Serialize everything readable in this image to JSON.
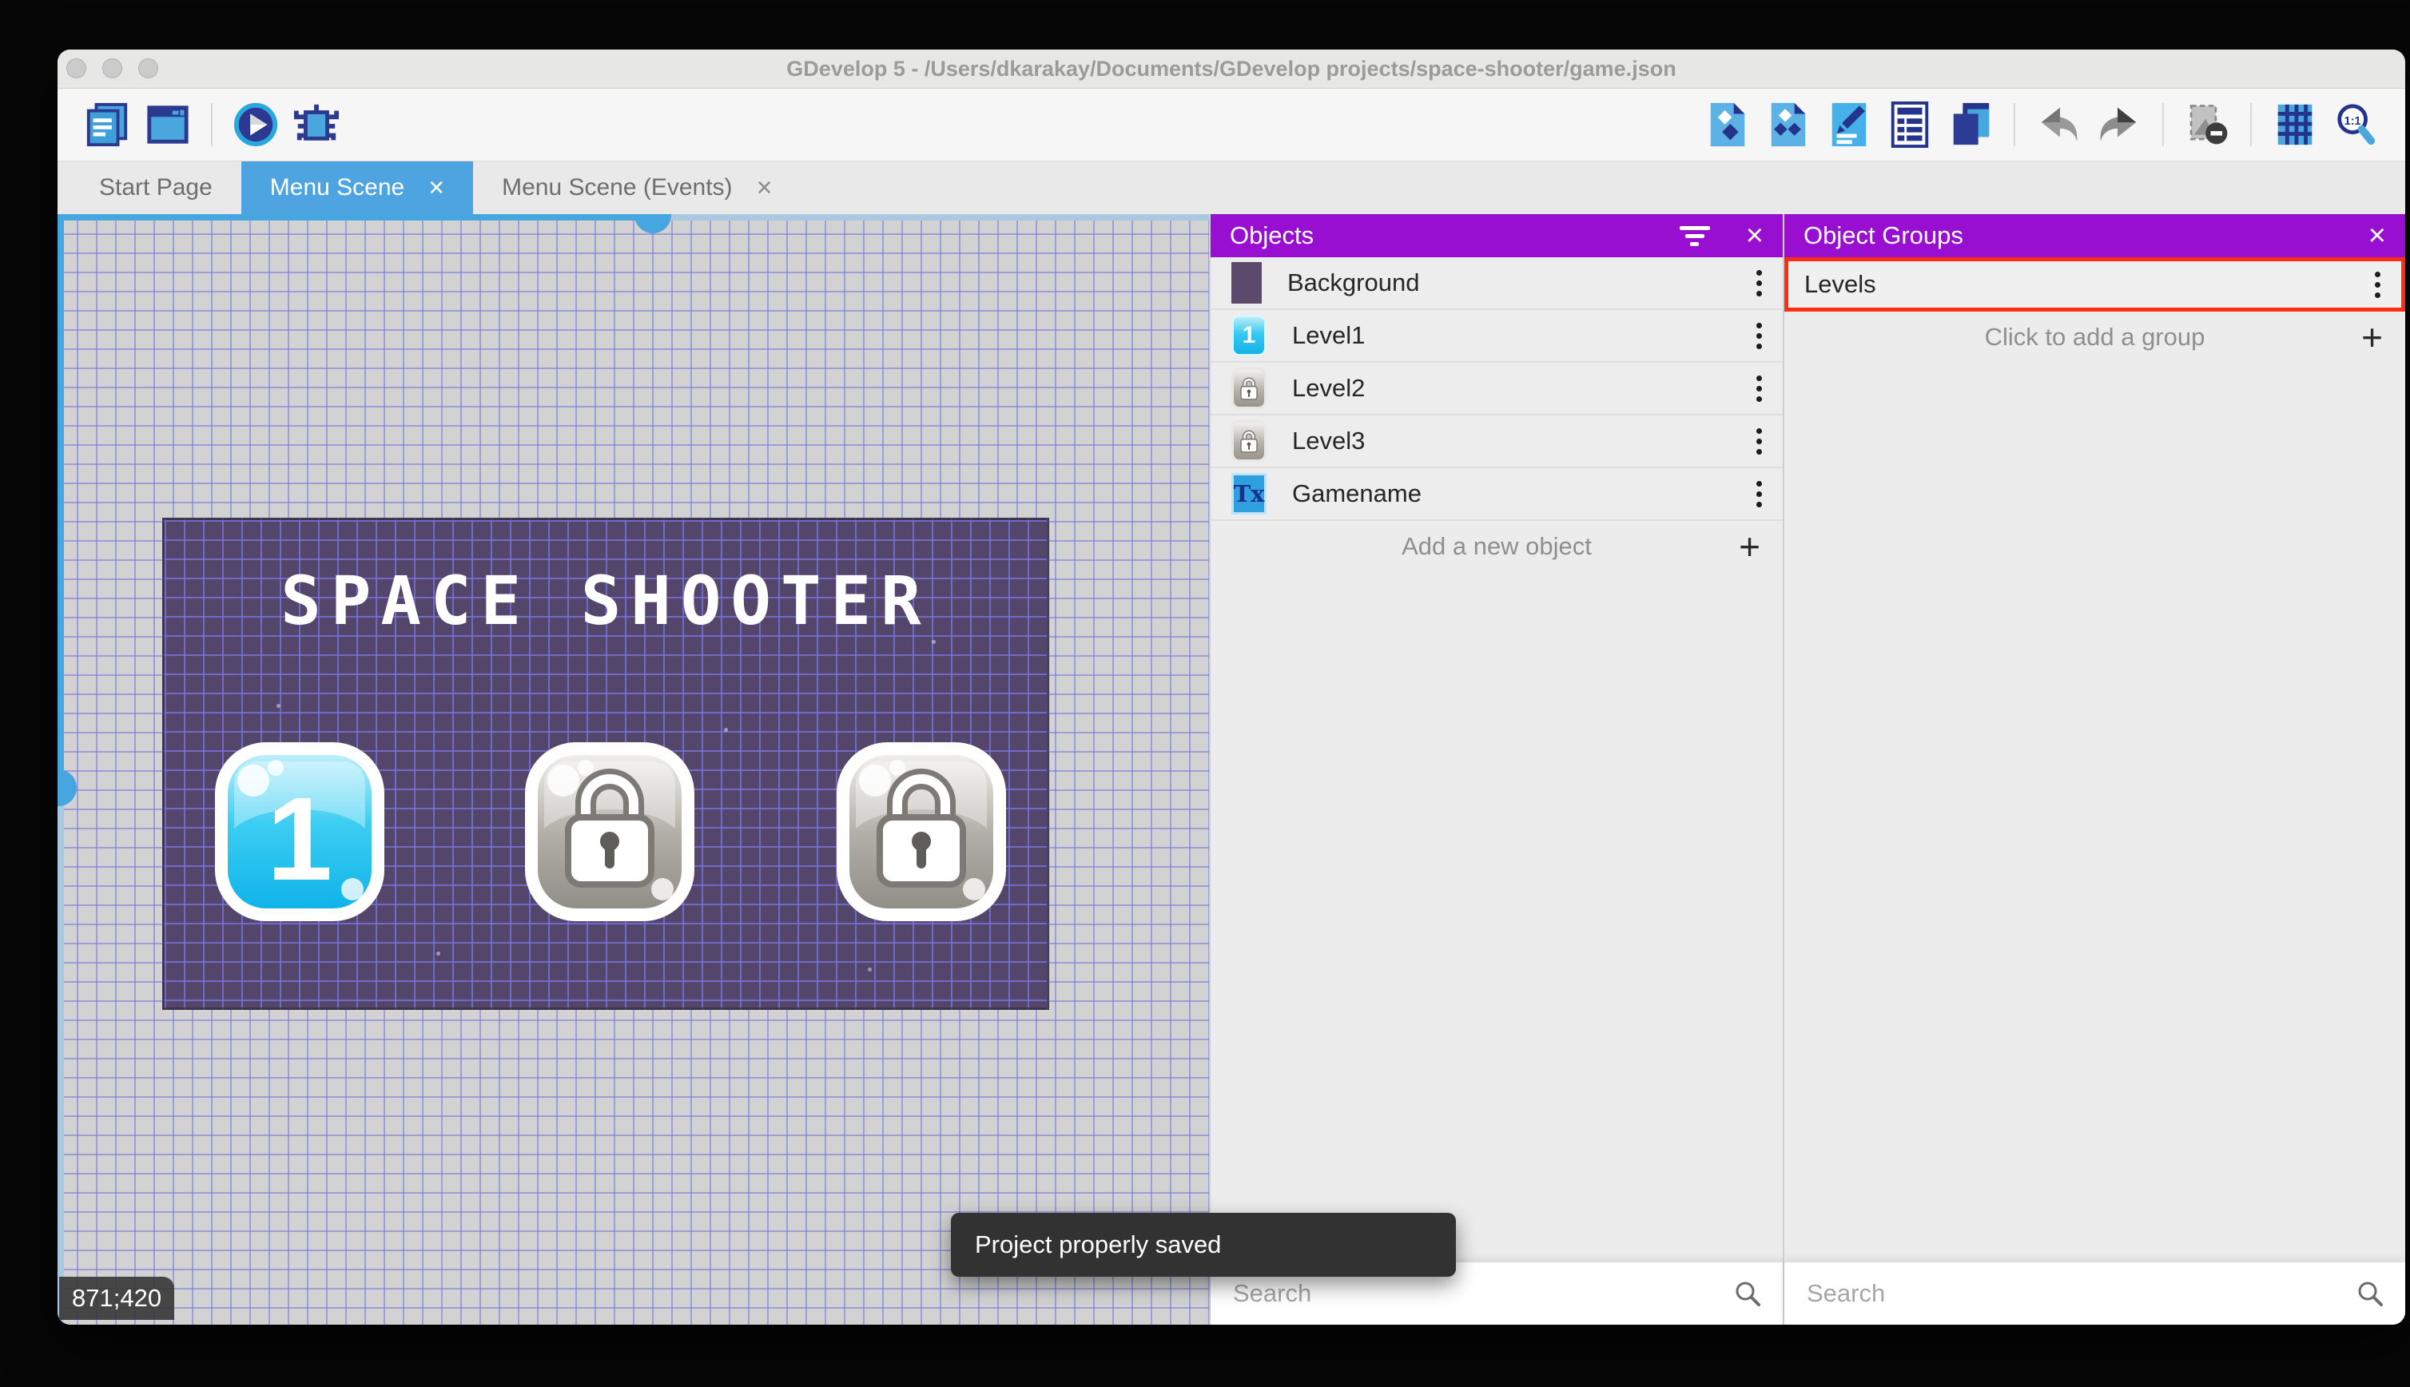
{
  "window": {
    "title": "GDevelop 5 - /Users/dkarakay/Documents/GDevelop projects/space-shooter/game.json"
  },
  "toolbar": {
    "left_icons": [
      "project-manager-icon",
      "scene-window-icon",
      "play-preview-icon",
      "debugger-icon"
    ],
    "right_icons": [
      "objects-panel-icon",
      "object-groups-panel-icon",
      "properties-icon",
      "instances-list-icon",
      "layers-icon",
      "undo-icon",
      "redo-icon",
      "mask-toggle-icon",
      "grid-toggle-icon",
      "zoom-original-icon"
    ],
    "zoom_ratio": "1:1"
  },
  "tabs": [
    {
      "label": "Start Page",
      "active": false,
      "closable": false
    },
    {
      "label": "Menu Scene",
      "active": true,
      "closable": true
    },
    {
      "label": "Menu Scene (Events)",
      "active": false,
      "closable": true
    }
  ],
  "glyphs": {
    "close": "×",
    "plus": "+"
  },
  "scene": {
    "title": "SPACE SHOOTER",
    "level1_label": "1",
    "coordinates": "871;420"
  },
  "objects_panel": {
    "title": "Objects",
    "items": [
      {
        "name": "Background",
        "thumb": "purple-rect"
      },
      {
        "name": "Level1",
        "thumb": "blue-button",
        "thumb_label": "1"
      },
      {
        "name": "Level2",
        "thumb": "locked-button"
      },
      {
        "name": "Level3",
        "thumb": "locked-button"
      },
      {
        "name": "Gamename",
        "thumb": "text-object",
        "thumb_label": "Tx"
      }
    ],
    "add_label": "Add a new object",
    "search_placeholder": "Search"
  },
  "groups_panel": {
    "title": "Object Groups",
    "items": [
      {
        "name": "Levels",
        "highlighted": true
      }
    ],
    "add_label": "Click to add a group",
    "search_placeholder": "Search"
  },
  "toast": {
    "message": "Project properly saved"
  },
  "colors": {
    "panel_header": "#990fd2",
    "active_tab": "#4da4e0",
    "highlight_border": "#ff2d12",
    "scene_background": "#53466a",
    "toast_background": "#323232"
  }
}
